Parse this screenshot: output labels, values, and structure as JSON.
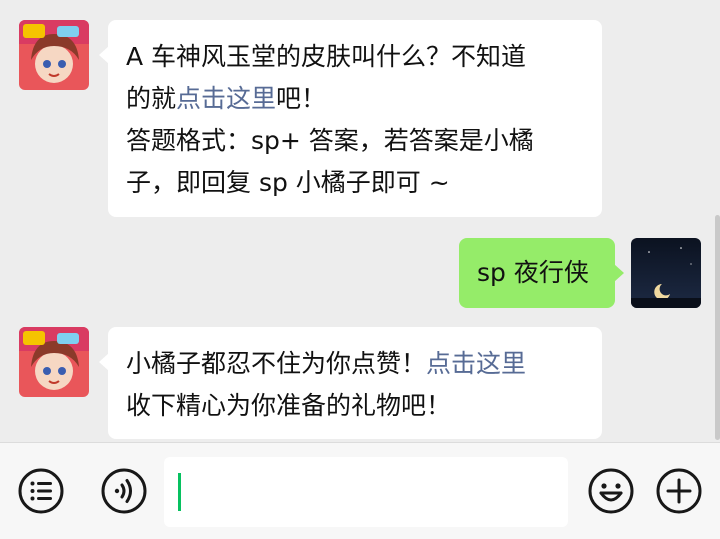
{
  "messages": [
    {
      "side": "left",
      "sender": "bot",
      "lines": [
        {
          "parts": [
            {
              "text": "A 车神风玉堂的皮肤叫什么？不知道",
              "link": false
            }
          ]
        },
        {
          "parts": [
            {
              "text": "的就",
              "link": false
            },
            {
              "text": "点击这里",
              "link": true
            },
            {
              "text": "吧！",
              "link": false
            }
          ]
        },
        {
          "parts": [
            {
              "text": "答题格式：sp+ 答案，若答案是小橘",
              "link": false
            }
          ]
        },
        {
          "parts": [
            {
              "text": "子，即回复 sp 小橘子即可 ~",
              "link": false
            }
          ]
        }
      ]
    },
    {
      "side": "right",
      "sender": "user",
      "text": "sp 夜行侠"
    },
    {
      "side": "left",
      "sender": "bot",
      "lines": [
        {
          "parts": [
            {
              "text": "小橘子都忍不住为你点赞！",
              "link": false
            },
            {
              "text": "点击这里",
              "link": true
            }
          ]
        },
        {
          "parts": [
            {
              "text": "收下精心为你准备的礼物吧！",
              "link": false
            }
          ]
        }
      ]
    }
  ],
  "input": {
    "value": ""
  },
  "icons": {
    "menu": "list-menu-icon",
    "voice": "voice-icon",
    "emoji": "emoji-icon",
    "more": "plus-icon"
  },
  "colors": {
    "background": "#ededed",
    "bubble_left": "#ffffff",
    "bubble_right": "#95ec69",
    "link": "#576b95",
    "cursor": "#07c160"
  }
}
